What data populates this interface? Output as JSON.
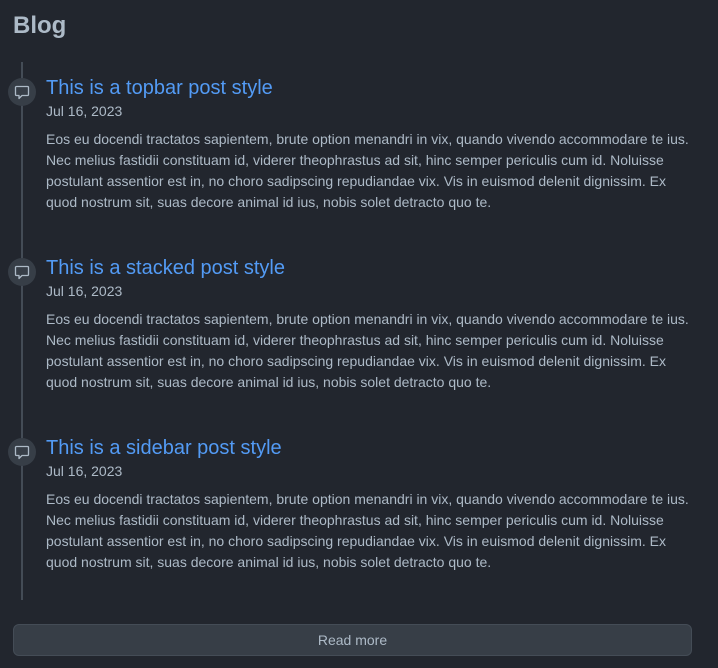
{
  "page": {
    "heading": "Blog"
  },
  "posts": [
    {
      "title": "This is a topbar post style",
      "date": "Jul 16, 2023",
      "excerpt": "Eos eu docendi tractatos sapientem, brute option menandri in vix, quando vivendo accommodare te ius. Nec melius fastidii constituam id, viderer theophrastus ad sit, hinc semper periculis cum id. Noluisse postulant assentior est in, no choro sadipscing repudiandae vix. Vis in euismod delenit dignissim. Ex quod nostrum sit, suas decore animal id ius, nobis solet detracto quo te.",
      "icon": "comment-icon"
    },
    {
      "title": "This is a stacked post style",
      "date": "Jul 16, 2023",
      "excerpt": "Eos eu docendi tractatos sapientem, brute option menandri in vix, quando vivendo accommodare te ius. Nec melius fastidii constituam id, viderer theophrastus ad sit, hinc semper periculis cum id. Noluisse postulant assentior est in, no choro sadipscing repudiandae vix. Vis in euismod delenit dignissim. Ex quod nostrum sit, suas decore animal id ius, nobis solet detracto quo te.",
      "icon": "comment-icon"
    },
    {
      "title": "This is a sidebar post style",
      "date": "Jul 16, 2023",
      "excerpt": "Eos eu docendi tractatos sapientem, brute option menandri in vix, quando vivendo accommodare te ius. Nec melius fastidii constituam id, viderer theophrastus ad sit, hinc semper periculis cum id. Noluisse postulant assentior est in, no choro sadipscing repudiandae vix. Vis in euismod delenit dignissim. Ex quod nostrum sit, suas decore animal id ius, nobis solet detracto quo te.",
      "icon": "comment-icon"
    }
  ],
  "read_more": {
    "label": "Read more"
  },
  "colors": {
    "background": "#22262e",
    "text": "#adbac7",
    "link": "#539bf5",
    "timeline": "#444c56",
    "button_bg": "#373e47"
  }
}
